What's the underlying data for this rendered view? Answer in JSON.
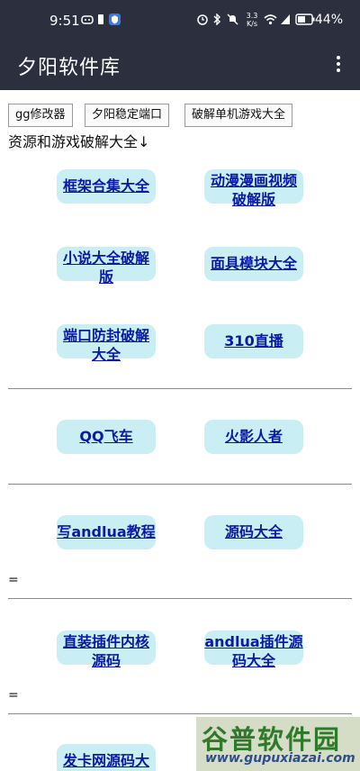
{
  "status_bar": {
    "time": "9:51",
    "net_speed": "3.3 K/s",
    "battery": "44%"
  },
  "app": {
    "title": "夕阳软件库"
  },
  "top_buttons": [
    {
      "label": "gg修改器"
    },
    {
      "label": "夕阳稳定端口"
    },
    {
      "label": "破解单机游戏大全"
    }
  ],
  "heading": "资源和游戏破解大全↓",
  "links": [
    {
      "label": "框架合集大全"
    },
    {
      "label": "动漫漫画视频破解版"
    },
    {
      "label": "小说大全破解版"
    },
    {
      "label": "面具模块大全"
    },
    {
      "label": "端口防封破解大全"
    },
    {
      "label": "310直播"
    },
    {
      "label": "QQ飞车"
    },
    {
      "label": "火影人者"
    },
    {
      "label": "写andlua教程"
    },
    {
      "label": "源码大全"
    },
    {
      "label": "直装插件内核源码"
    },
    {
      "label": "andlua插件源码大全"
    },
    {
      "label": "发卡网源码大"
    }
  ],
  "separators": [
    "=",
    "="
  ],
  "watermark": {
    "name": "谷普软件园",
    "url": "www.gupuxiazai.com"
  }
}
